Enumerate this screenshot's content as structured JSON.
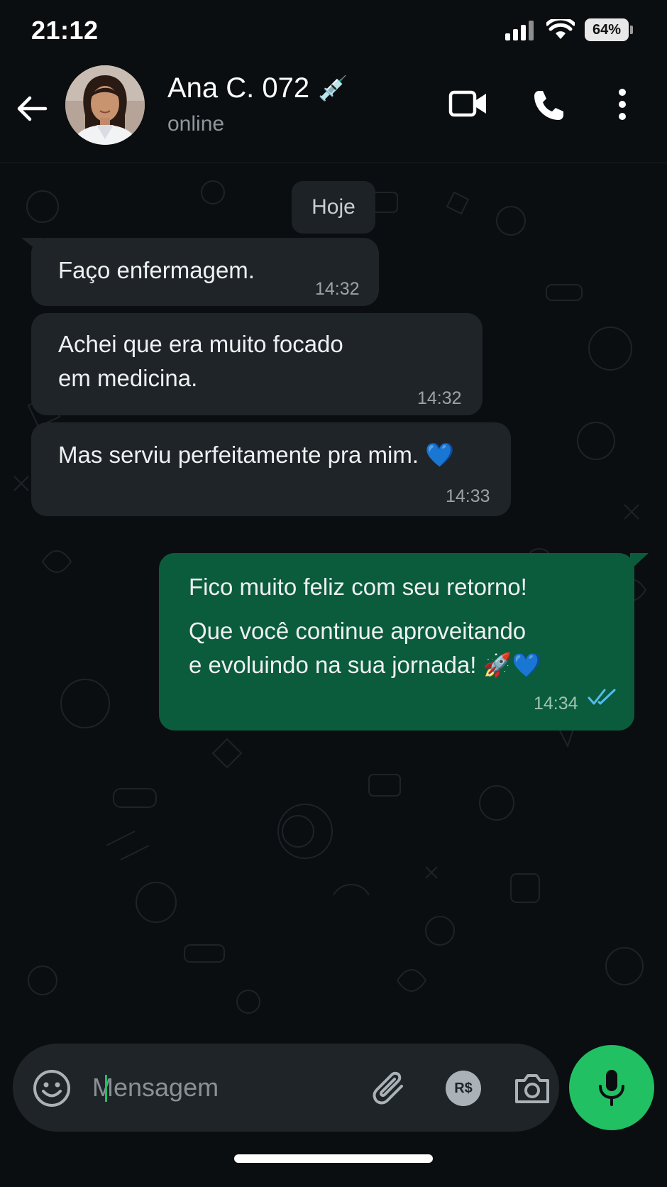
{
  "status_bar": {
    "time": "21:12",
    "battery": "64%"
  },
  "header": {
    "contact_name": "Ana C. 072",
    "name_emoji": "💉",
    "status": "online",
    "icons": [
      "back-arrow-icon",
      "video-call-icon",
      "voice-call-icon",
      "more-options-icon"
    ]
  },
  "chat": {
    "date_label": "Hoje",
    "messages": [
      {
        "direction": "in",
        "lines": [
          "Faço enfermagem."
        ],
        "time": "14:32"
      },
      {
        "direction": "in",
        "lines": [
          "Achei que era muito focado",
          "em medicina."
        ],
        "time": "14:32"
      },
      {
        "direction": "in",
        "lines": [
          "Mas serviu perfeitamente pra mim. 💙"
        ],
        "time": "14:33"
      },
      {
        "direction": "out",
        "lines": [
          "Fico muito feliz com seu retorno!",
          "Que você continue aproveitando",
          "e evoluindo na sua jornada! 🚀💙"
        ],
        "time": "14:34",
        "read": true
      }
    ]
  },
  "composer": {
    "placeholder": "Mensagem",
    "value": "",
    "icons": [
      "emoji-icon",
      "attachment-icon",
      "payment-icon",
      "camera-icon",
      "microphone-icon"
    ],
    "pay_label": "R$"
  },
  "colors": {
    "background": "#0b0e11",
    "incoming_bubble": "#1f2428",
    "outgoing_bubble": "#0b5c3d",
    "accent": "#21c063",
    "read_ticks": "#53bdeb"
  }
}
